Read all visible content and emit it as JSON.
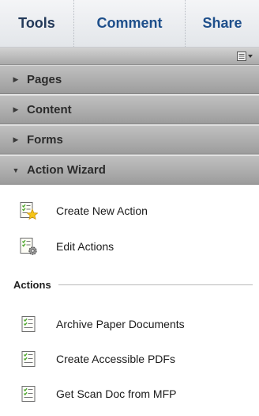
{
  "tabs": [
    {
      "label": "Tools"
    },
    {
      "label": "Comment"
    },
    {
      "label": "Share"
    }
  ],
  "options_icon": "panel-options-icon",
  "sections": [
    {
      "label": "Pages",
      "expanded": false
    },
    {
      "label": "Content",
      "expanded": false
    },
    {
      "label": "Forms",
      "expanded": false
    },
    {
      "label": "Action Wizard",
      "expanded": true
    }
  ],
  "wizard_items": [
    {
      "label": "Create New Action",
      "icon": "create-action-icon"
    },
    {
      "label": "Edit Actions",
      "icon": "edit-actions-icon"
    }
  ],
  "actions_heading": "Actions",
  "actions": [
    {
      "label": "Archive Paper Documents",
      "icon": "action-list-icon"
    },
    {
      "label": "Create Accessible PDFs",
      "icon": "action-list-icon"
    },
    {
      "label": "Get Scan Doc from MFP",
      "icon": "action-list-icon"
    }
  ],
  "colors": {
    "tab_text": "#1e4f8b",
    "section_bg": "#b0b0b0",
    "icon_green": "#4ea82e"
  }
}
